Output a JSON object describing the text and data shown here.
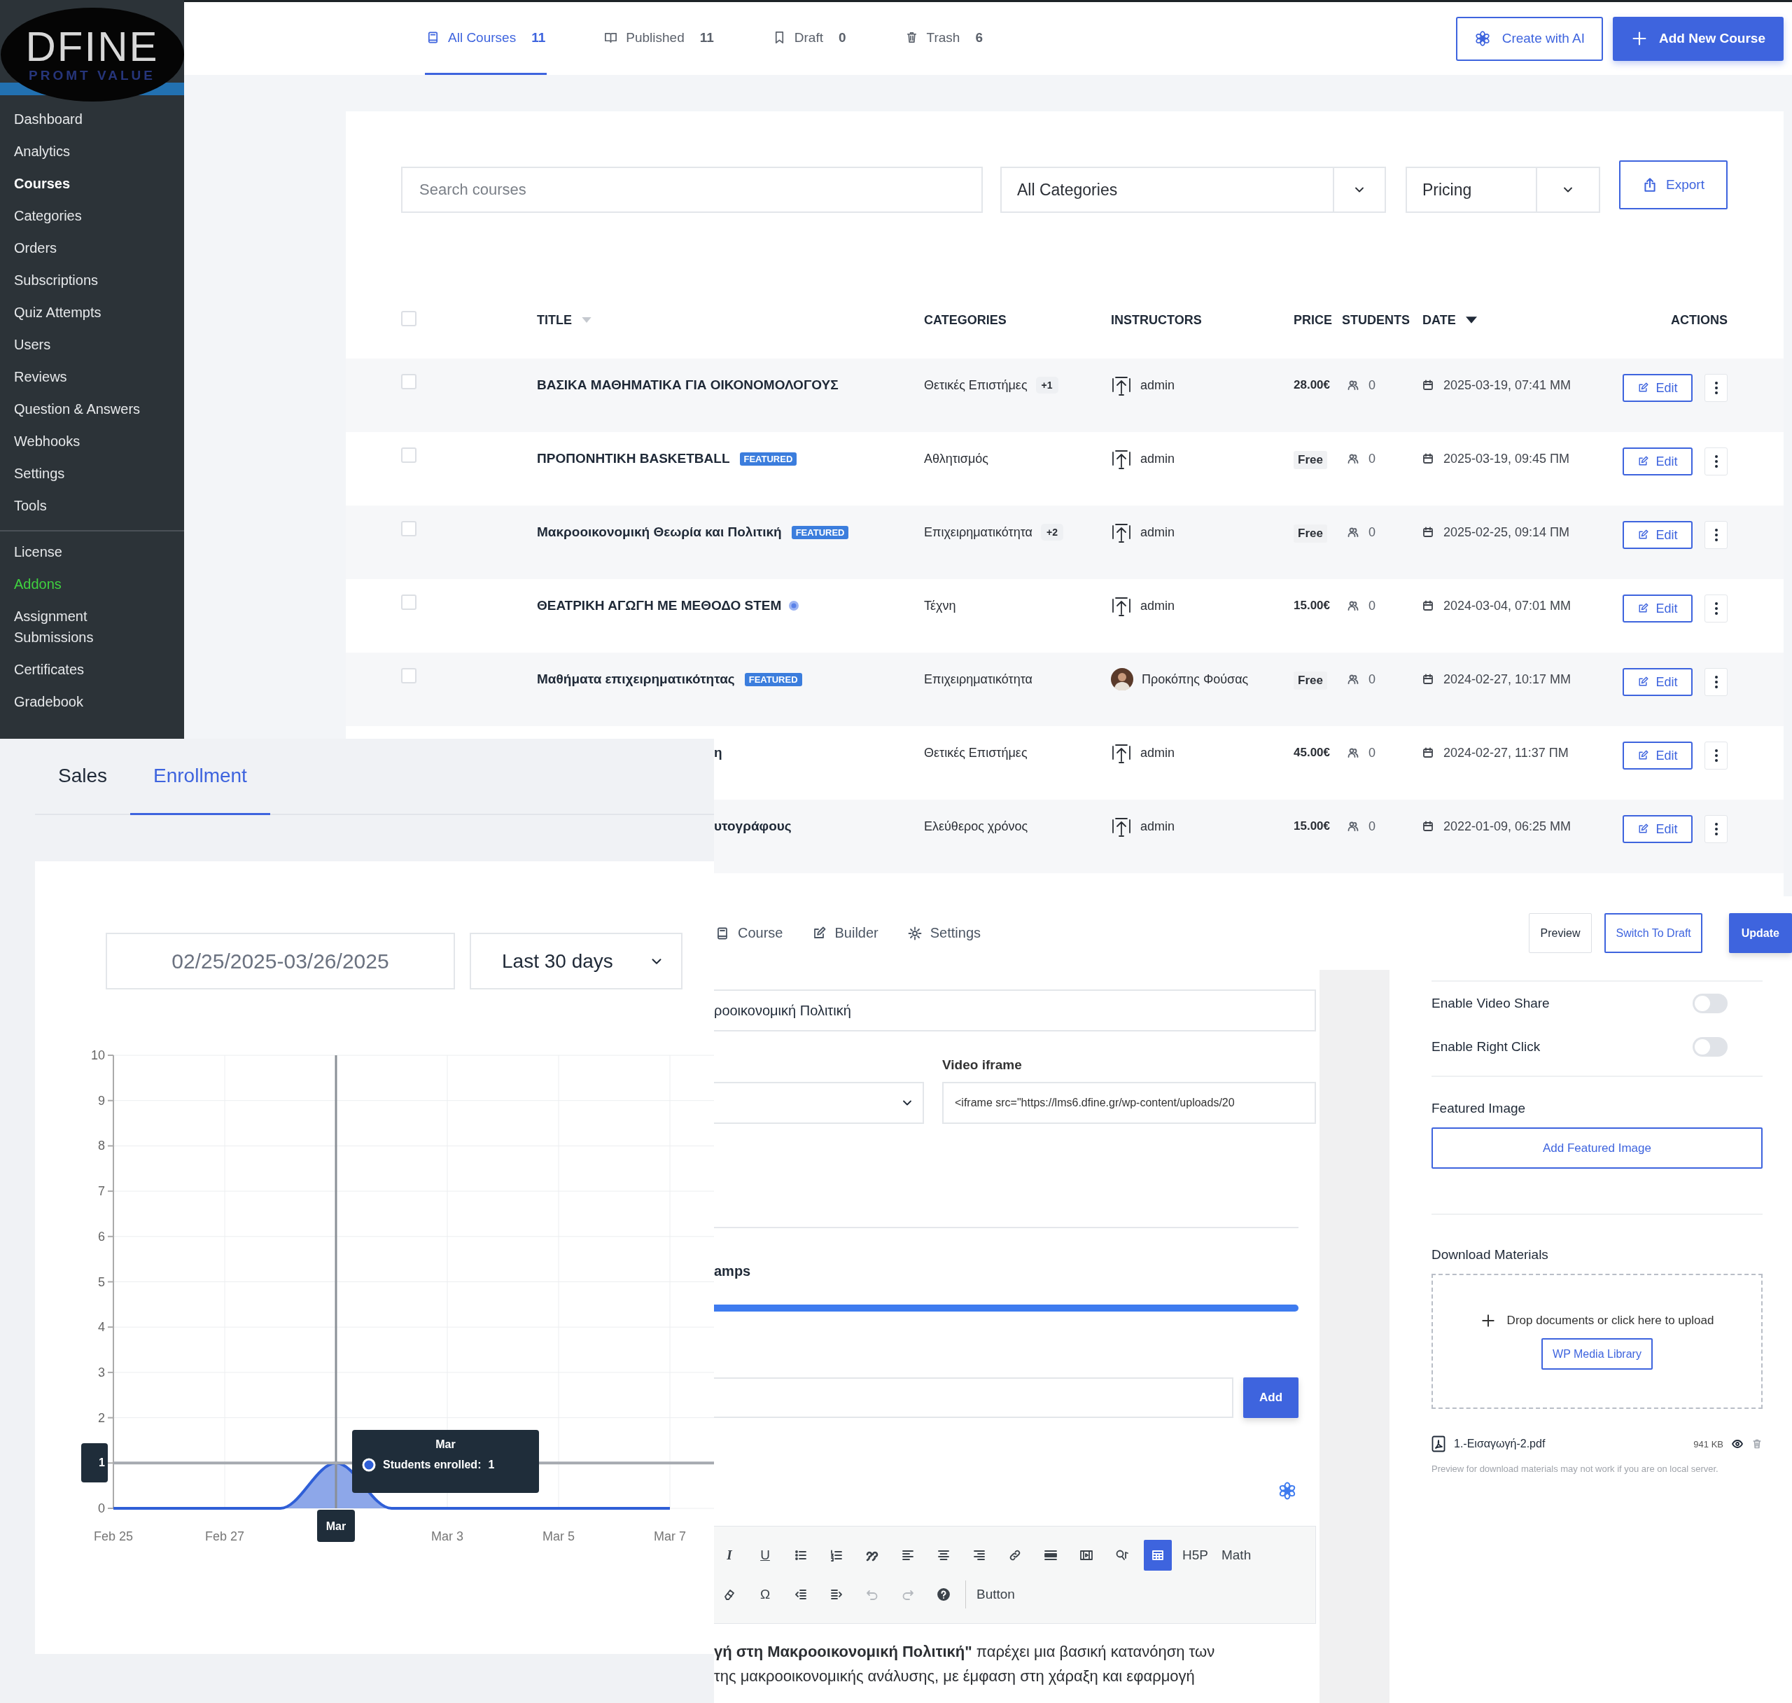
{
  "sidebar": {
    "logo": {
      "text": "DFINE",
      "tagline": "PROMT VALUE"
    },
    "items": [
      {
        "label": "Dashboard",
        "selected": false
      },
      {
        "label": "Analytics",
        "selected": false
      },
      {
        "label": "Courses",
        "selected": true
      },
      {
        "label": "Categories",
        "selected": false
      },
      {
        "label": "Orders",
        "selected": false
      },
      {
        "label": "Subscriptions",
        "selected": false
      },
      {
        "label": "Quiz Attempts",
        "selected": false
      },
      {
        "label": "Users",
        "selected": false
      },
      {
        "label": "Reviews",
        "selected": false
      },
      {
        "label": "Question & Answers",
        "selected": false
      },
      {
        "label": "Webhooks",
        "selected": false
      },
      {
        "label": "Settings",
        "selected": false
      },
      {
        "label": "Tools",
        "selected": false
      }
    ],
    "lower_items": [
      {
        "label": "License",
        "highlight": false
      },
      {
        "label": "Addons",
        "highlight": true
      },
      {
        "label": "Assignment Submissions",
        "highlight": false
      },
      {
        "label": "Certificates",
        "highlight": false
      },
      {
        "label": "Gradebook",
        "highlight": false
      }
    ]
  },
  "course_tabs": [
    {
      "label": "All Courses",
      "count": "11",
      "selected": true,
      "kind": "book"
    },
    {
      "label": "Published",
      "count": "11",
      "selected": false,
      "kind": "open-book"
    },
    {
      "label": "Draft",
      "count": "0",
      "selected": false,
      "kind": "bookmark"
    },
    {
      "label": "Trash",
      "count": "6",
      "selected": false,
      "kind": "trash"
    }
  ],
  "header_buttons": [
    {
      "label": "Create with AI",
      "kind": "outline"
    },
    {
      "label": "Add New Course",
      "kind": "primary"
    }
  ],
  "filters": {
    "search_placeholder": "Search courses",
    "category": "All Categories",
    "pricing": "Pricing",
    "export": "Export"
  },
  "table": {
    "select_all_checked": false,
    "columns": [
      {
        "label": "TITLE",
        "sortable": true,
        "sorted": false
      },
      {
        "label": "CATEGORIES",
        "sortable": false
      },
      {
        "label": "INSTRUCTORS",
        "sortable": false
      },
      {
        "label": "PRICE",
        "sortable": false
      },
      {
        "label": "STUDENTS",
        "sortable": false
      },
      {
        "label": "DATE",
        "sortable": true,
        "sorted": true
      },
      {
        "label": "ACTIONS",
        "sortable": false
      }
    ],
    "rows": [
      {
        "checked": false,
        "title_cut": false,
        "title": "ΒΑΣΙΚΑ ΜΑΘΗΜΑΤΙΚΑ ΓΙΑ ΟΙΚΟΝΟΜΟΛΟΓΟΥΣ",
        "featured": false,
        "verified": false,
        "category": "Θετικές Επιστήμες",
        "category_more": "+1",
        "instructor": "admin",
        "has_photo": false,
        "price": "28.00€",
        "price_badge": false,
        "students": "0",
        "date": "2025-03-19, 07:41 ΜΜ",
        "action": "Edit"
      },
      {
        "checked": false,
        "title_cut": false,
        "title": "ΠΡΟΠΟΝΗΤΙΚΗ BASKETBALL",
        "featured": true,
        "featured_label": "FEATURED",
        "verified": false,
        "category": "Αθλητισμός",
        "instructor": "admin",
        "has_photo": false,
        "price": "Free",
        "price_badge": true,
        "students": "0",
        "date": "2025-03-19, 09:45 ΠΜ",
        "action": "Edit"
      },
      {
        "checked": false,
        "title_cut": false,
        "title": "Μακροοικονομική Θεωρία και Πολιτική",
        "featured": true,
        "featured_label": "FEATURED",
        "verified": false,
        "category": "Επιχειρηματικότητα",
        "category_more": "+2",
        "instructor": "admin",
        "has_photo": false,
        "price": "Free",
        "price_badge": true,
        "students": "0",
        "date": "2025-02-25, 09:14 ΠΜ",
        "action": "Edit"
      },
      {
        "checked": false,
        "title_cut": false,
        "title": "ΘΕΑΤΡΙΚΗ ΑΓΩΓΗ ΜΕ ΜΕΘΟΔΟ STEM",
        "featured": false,
        "verified": true,
        "category": "Τέχνη",
        "instructor": "admin",
        "has_photo": false,
        "price": "15.00€",
        "price_badge": false,
        "students": "0",
        "date": "2024-03-04, 07:01 ΜΜ",
        "action": "Edit"
      },
      {
        "checked": false,
        "title_cut": false,
        "title": "Μαθήματα επιχειρηματικότητας",
        "featured": true,
        "featured_label": "FEATURED",
        "verified": false,
        "category": "Επιχειρηματικότητα",
        "instructor": "Προκόπης Φούσας",
        "has_photo": true,
        "price": "Free",
        "price_badge": true,
        "students": "0",
        "date": "2024-02-27, 10:17 ΜΜ",
        "action": "Edit"
      },
      {
        "title_cut": true,
        "title": "η",
        "featured": false,
        "verified": false,
        "category": "Θετικές Επιστήμες",
        "instructor": "admin",
        "has_photo": false,
        "price": "45.00€",
        "price_badge": false,
        "students": "0",
        "date": "2024-02-27, 11:37 ΠΜ",
        "action": "Edit"
      },
      {
        "title_cut": true,
        "title": "υτογράφους",
        "featured": false,
        "verified": false,
        "category": "Ελεύθερος χρόνος",
        "instructor": "admin",
        "has_photo": false,
        "price": "15.00€",
        "price_badge": false,
        "students": "0",
        "date": "2022-01-09, 06:25 ΜΜ",
        "action": "Edit"
      }
    ]
  },
  "analytics": {
    "tabs": [
      {
        "label": "Sales",
        "selected": false
      },
      {
        "label": "Enrollment",
        "selected": true
      }
    ],
    "date_range": "02/25/2025-03/26/2025",
    "period": "Last 30 days",
    "chart_data": {
      "type": "area",
      "categories": [
        "Feb 25",
        null,
        "Feb 27",
        null,
        "Mar",
        null,
        "Mar 3",
        null,
        "Mar 5",
        null,
        "Mar 7"
      ],
      "series": [
        {
          "color": "#2f5fd7",
          "values": [
            0,
            0,
            0,
            0,
            1,
            0,
            0,
            0,
            0,
            0,
            0
          ]
        }
      ],
      "yticks": [
        {
          "value": 0,
          "label": "0"
        },
        {
          "value": 1,
          "label": "1"
        },
        {
          "value": 2,
          "label": "2"
        },
        {
          "value": 3,
          "label": "3"
        },
        {
          "value": 4,
          "label": "4"
        },
        {
          "value": 5,
          "label": "5"
        },
        {
          "value": 6,
          "label": "6"
        },
        {
          "value": 7,
          "label": "7"
        },
        {
          "value": 8,
          "label": "8"
        },
        {
          "value": 9,
          "label": "9"
        },
        {
          "value": 10,
          "label": "10"
        }
      ],
      "ylim": [
        0,
        10
      ],
      "grid": true,
      "ref_lines": [
        {
          "axis": "x",
          "value": "Mar"
        },
        {
          "axis": "y",
          "value": 1
        }
      ]
    },
    "tooltip": {
      "title": "Mar",
      "label": "Students enrolled:",
      "value": "1"
    }
  },
  "editor": {
    "tabs": [
      {
        "label": "Course",
        "kind": "book"
      },
      {
        "label": "Builder",
        "kind": "edit"
      },
      {
        "label": "Settings",
        "kind": "cog"
      }
    ],
    "actions": [
      {
        "label": "Preview",
        "kind": "plain"
      },
      {
        "label": "Switch To Draft",
        "kind": "outline"
      },
      {
        "label": "Update",
        "kind": "primary"
      }
    ],
    "title_value": "ροοικονομική Πολιτική",
    "video_label": "Video iframe",
    "video_value": "<iframe src=\"https://lms6.dfine.gr/wp-content/uploads/20",
    "section_heading": "amps",
    "add_button": "Add",
    "toolbar": [
      [
        {
          "kind": "italic",
          "text": "I",
          "active": false,
          "disabled": false
        },
        {
          "kind": "underline",
          "text": "U",
          "active": false,
          "disabled": false
        },
        {
          "kind": "bullet-list",
          "active": false,
          "disabled": false
        },
        {
          "kind": "numbered-list",
          "active": false,
          "disabled": false
        },
        {
          "kind": "quote",
          "active": false,
          "disabled": false
        },
        {
          "kind": "align-left",
          "active": false,
          "disabled": false
        },
        {
          "kind": "align-center",
          "active": false,
          "disabled": false
        },
        {
          "kind": "align-right",
          "active": false,
          "disabled": false
        },
        {
          "kind": "link",
          "active": false,
          "disabled": false
        },
        {
          "kind": "rule",
          "active": false,
          "disabled": false
        },
        {
          "kind": "media",
          "active": false,
          "disabled": false
        },
        {
          "kind": "symbol",
          "active": false,
          "disabled": false
        },
        {
          "kind": "table",
          "active": true,
          "disabled": false
        },
        {
          "kind": "text",
          "text": "H5P",
          "active": false,
          "disabled": false
        },
        {
          "kind": "text",
          "text": "Math",
          "active": false,
          "disabled": false
        }
      ],
      [
        {
          "kind": "eraser",
          "active": false,
          "disabled": false
        },
        {
          "kind": "text",
          "text": "Ω",
          "active": false,
          "disabled": false
        },
        {
          "kind": "outdent",
          "active": false,
          "disabled": false
        },
        {
          "kind": "indent",
          "active": false,
          "disabled": false
        },
        {
          "kind": "undo",
          "active": false,
          "disabled": true
        },
        {
          "kind": "redo",
          "active": false,
          "disabled": true
        },
        {
          "kind": "help",
          "active": false,
          "disabled": false
        },
        {
          "kind": "separator"
        },
        {
          "kind": "text",
          "text": "Button",
          "active": false,
          "disabled": false
        }
      ]
    ],
    "description": [
      "**γή στη Μακροοικονομική Πολιτική\"** παρέχει μια βασική κατανόηση των",
      "της μακροοικονομικής ανάλυσης, με έμφαση στη χάραξη και εφαρμογή"
    ]
  },
  "settings_panel": {
    "toggles": [
      {
        "label": "Enable Video Share",
        "on": false
      },
      {
        "label": "Enable Right Click",
        "on": false
      }
    ],
    "featured_image": {
      "heading": "Featured Image",
      "button": "Add Featured Image"
    },
    "materials": {
      "heading": "Download Materials",
      "drop_text": "Drop documents or click here to upload",
      "library_button": "WP Media Library",
      "files": [
        {
          "name": "1.-Εισαγωγή-2.pdf",
          "size": "941 KB"
        }
      ],
      "note": "Preview for download materials may not work if you are on local server."
    }
  }
}
